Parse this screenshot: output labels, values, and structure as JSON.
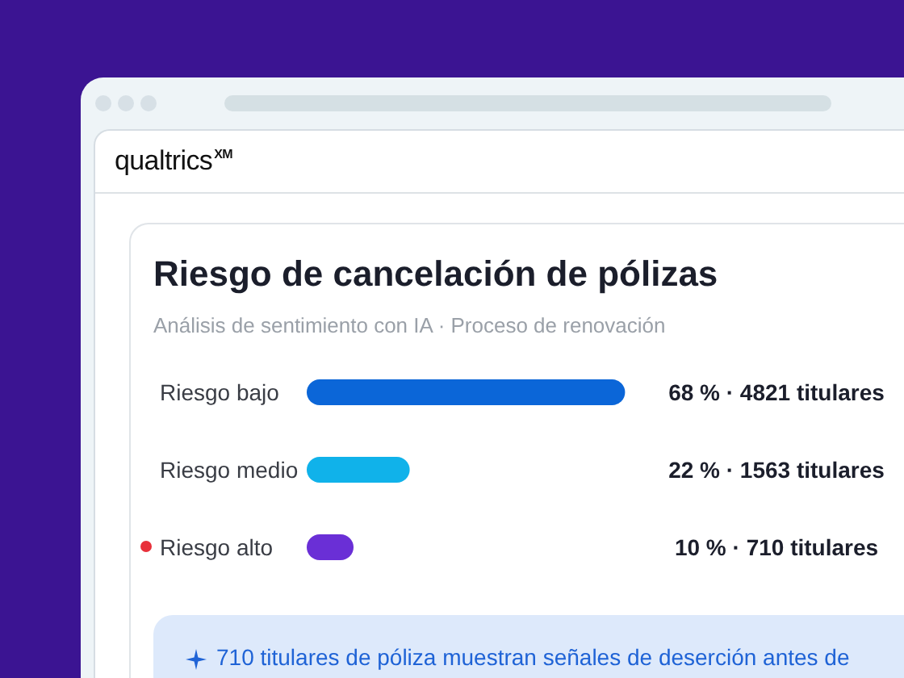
{
  "brand": {
    "name": "qualtrics",
    "mark": "XM"
  },
  "card": {
    "title": "Riesgo de cancelación de pólizas",
    "subtitle": "Análisis de sentimiento con IA · Proceso de renovación",
    "chart_data": {
      "type": "bar",
      "orientation": "horizontal",
      "categories": [
        "Riesgo bajo",
        "Riesgo medio",
        "Riesgo alto"
      ],
      "values": [
        68,
        22,
        10
      ],
      "value_labels": [
        "68 % · 4821 titulares",
        "22 % · 1563 titulares",
        "10 % · 710 titulares"
      ]
    },
    "rows": [
      {
        "color": "#0b66d8",
        "flagged": false
      },
      {
        "color": "#10b2ea",
        "flagged": false
      },
      {
        "color": "#6a2fd6",
        "flagged": true
      }
    ],
    "insight": "710 titulares de póliza muestran señales de deserción antes de"
  }
}
